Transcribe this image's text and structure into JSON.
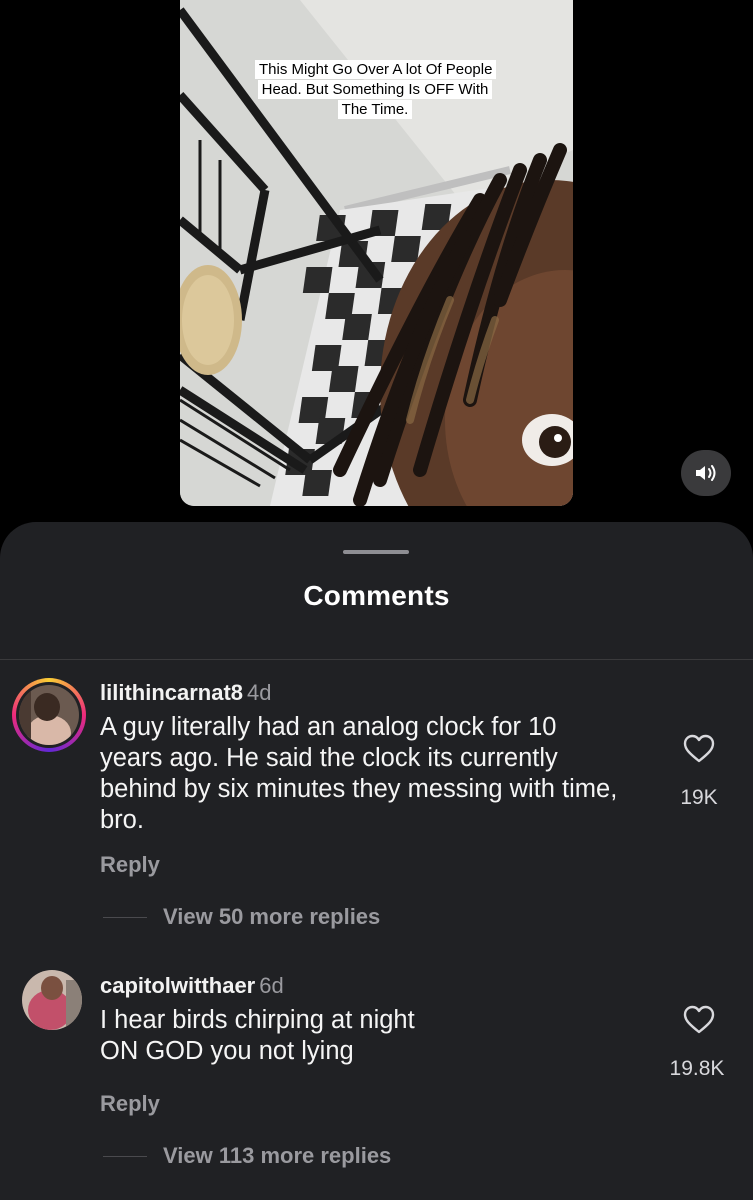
{
  "video": {
    "caption": "This Might Go Over A lot Of People Head. But Something Is OFF With The Time.",
    "mute_icon": "speaker-icon"
  },
  "sheet": {
    "title": "Comments"
  },
  "comments": [
    {
      "username": "lilithincarnat8",
      "time": "4d",
      "text": "A guy literally had an analog clock for 10 years ago. He said the clock its currently behind by six minutes they messing with time, bro.",
      "likes": "19K",
      "reply_label": "Reply",
      "view_replies": "View 50 more replies"
    },
    {
      "username": "capitolwitthaer",
      "time": "6d",
      "text_line1": "I hear birds chirping at night",
      "text_line2": "ON GOD you not lying",
      "likes": "19.8K",
      "reply_label": "Reply",
      "view_replies": "View 113 more replies"
    }
  ],
  "colors": {
    "background": "#000000",
    "sheet": "#202124",
    "muted_text": "#9a9a9f"
  }
}
